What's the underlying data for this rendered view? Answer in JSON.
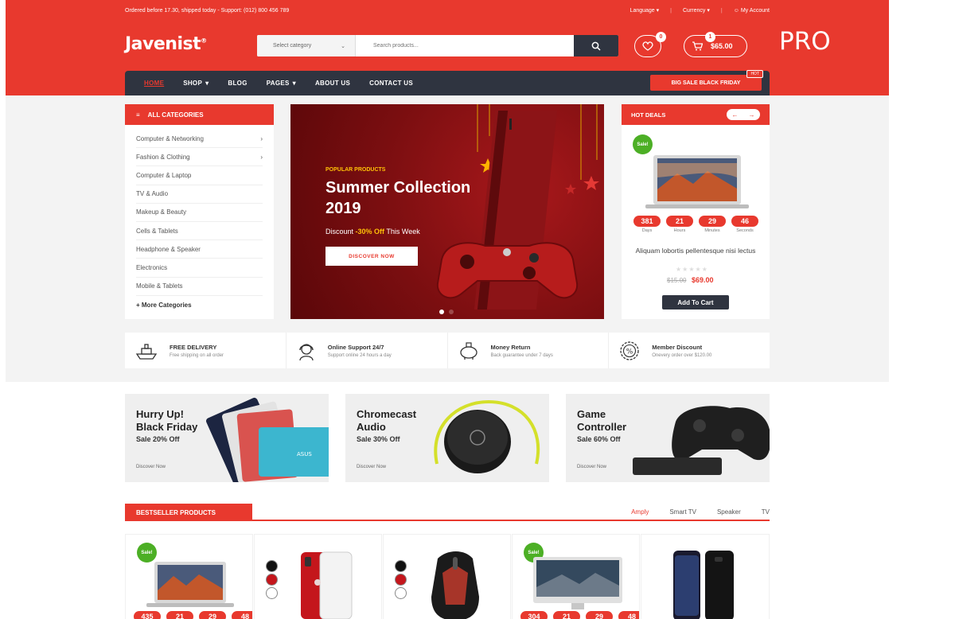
{
  "topbar": {
    "notice": "Ordered before 17.30, shipped today - Support: (012) 800 456 789",
    "language": "Language",
    "currency": "Currency",
    "account": "My Account"
  },
  "header": {
    "logo": "Javenist",
    "search_category": "Select category",
    "search_placeholder": "Search products...",
    "wishlist_count": "0",
    "cart_count": "1",
    "cart_total": "$65.00",
    "badge": "PRO"
  },
  "nav": {
    "items": [
      {
        "label": "HOME"
      },
      {
        "label": "SHOP"
      },
      {
        "label": "BLOG"
      },
      {
        "label": "PAGES"
      },
      {
        "label": "ABOUT US"
      },
      {
        "label": "CONTACT US"
      }
    ],
    "sale_label": "BIG SALE BLACK FRIDAY",
    "hot_tag": "HOT"
  },
  "categories": {
    "title": "ALL CATEGORIES",
    "items": [
      "Computer & Networking",
      "Fashion & Clothing",
      "Computer & Laptop",
      "TV & Audio",
      "Makeup & Beauty",
      "Cells & Tablets",
      "Headphone & Speaker",
      "Electronics",
      "Mobile & Tablets"
    ],
    "more": "+ More Categories"
  },
  "banner": {
    "kicker": "POPULAR PRODUCTS",
    "title": "Summer Collection 2019",
    "discount_prefix": "Discount ",
    "discount_value": "-30% Off",
    "discount_suffix": " This Week",
    "cta": "DISCOVER NOW"
  },
  "hot_deals": {
    "title": "HOT DEALS",
    "sale": "Sale!",
    "countdown": [
      {
        "value": "381",
        "label": "Days"
      },
      {
        "value": "21",
        "label": "Hours"
      },
      {
        "value": "29",
        "label": "Minutes"
      },
      {
        "value": "46",
        "label": "Seconds"
      }
    ],
    "product_name": "Aliquam lobortis pellentesque nisi lectus",
    "old_price": "$15.00",
    "price": "$69.00",
    "add_to_cart": "Add To Cart"
  },
  "features": [
    {
      "title": "FREE DELIVERY",
      "sub": "Free shipping on all order"
    },
    {
      "title": "Online Support 24/7",
      "sub": "Support online 24 hours a day"
    },
    {
      "title": "Money Return",
      "sub": "Back guarantee under 7 days"
    },
    {
      "title": "Member Discount",
      "sub": "Onevery order over $120.00"
    }
  ],
  "promos": [
    {
      "title_l1": "Hurry Up!",
      "title_l2": "Black Friday",
      "sub": "Sale 20% Off",
      "link": "Discover Now"
    },
    {
      "title_l1": "Chromecast",
      "title_l2": "Audio",
      "sub": "Sale 30% Off",
      "link": "Discover Now"
    },
    {
      "title_l1": "Game",
      "title_l2": "Controller",
      "sub": "Sale 60% Off",
      "link": "Discover Now"
    }
  ],
  "bestseller": {
    "title": "BESTSELLER PRODUCTS",
    "tabs": [
      "Amply",
      "Smart TV",
      "Speaker",
      "TV"
    ],
    "sale": "Sale!",
    "p1_countdown": [
      "435",
      "21",
      "29",
      "48"
    ],
    "p4_countdown": [
      "304",
      "21",
      "29",
      "48"
    ]
  },
  "colors": {
    "brand": "#e8392e",
    "dark": "#2f3440",
    "sale_green": "#4caf25",
    "accent": "#ffc107"
  }
}
